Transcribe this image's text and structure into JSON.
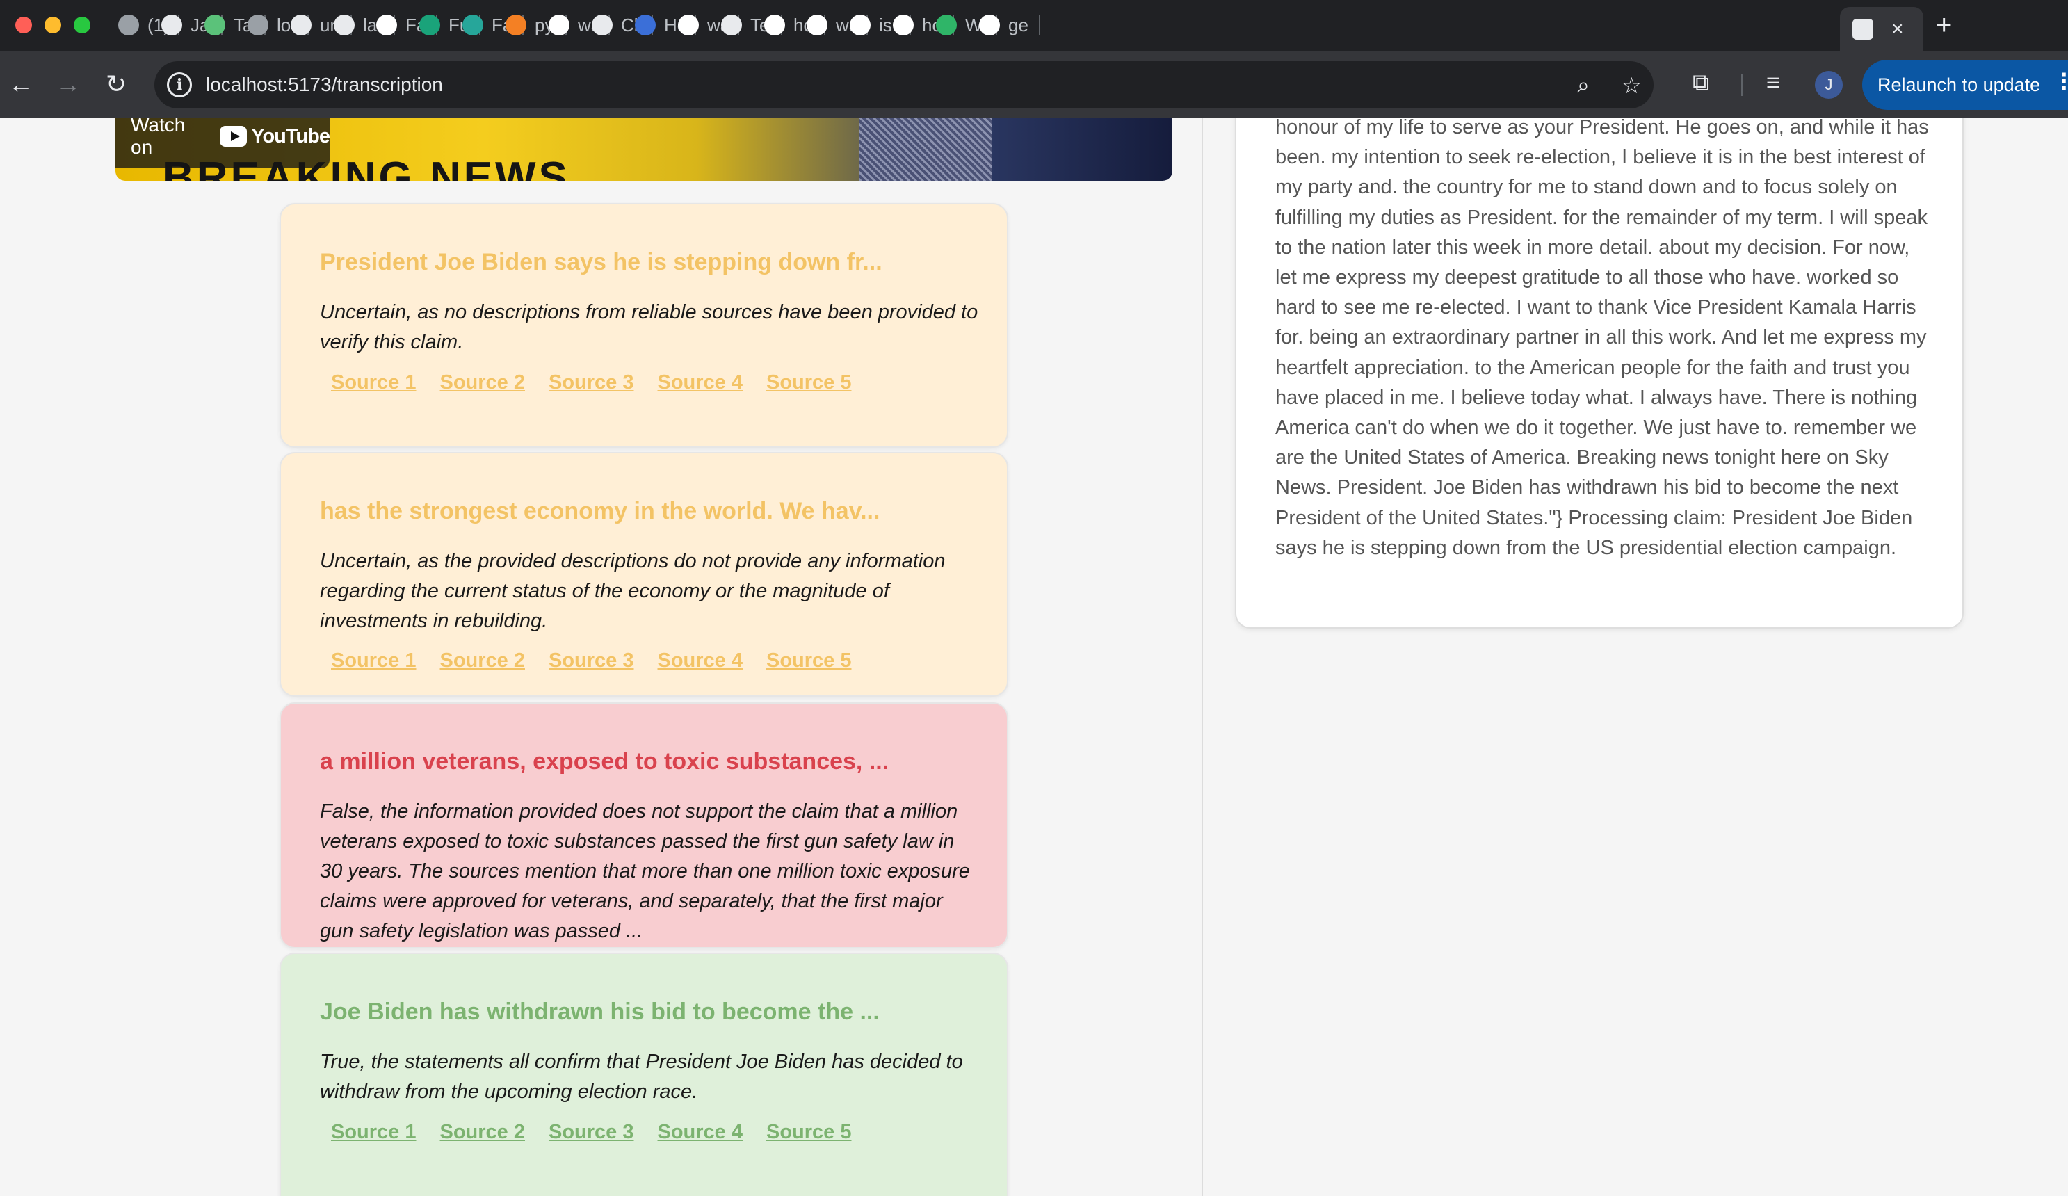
{
  "browser": {
    "tabs": [
      {
        "label": "(1)",
        "favicon": "laptop-icon",
        "color": "#9aa0a6"
      },
      {
        "label": "Ja",
        "favicon": "github-icon",
        "color": "#e8eaed"
      },
      {
        "label": "Ta",
        "favicon": "person-icon",
        "color": "#5bc27a"
      },
      {
        "label": "loc",
        "favicon": "globe-icon",
        "color": "#9aa0a6"
      },
      {
        "label": "un",
        "favicon": "github-icon",
        "color": "#e8eaed"
      },
      {
        "label": "lat",
        "favicon": "github-icon",
        "color": "#e8eaed"
      },
      {
        "label": "Fa",
        "favicon": "google-icon",
        "color": "#ffffff"
      },
      {
        "label": "Fu",
        "favicon": "bolt-icon",
        "color": "#1aa37a"
      },
      {
        "label": "Fa",
        "favicon": "doc-icon",
        "color": "#26a69a"
      },
      {
        "label": "py",
        "favicon": "stackoverflow-icon",
        "color": "#f48024"
      },
      {
        "label": "wa",
        "favicon": "google-icon",
        "color": "#ffffff"
      },
      {
        "label": "Cl",
        "favicon": "openai-icon",
        "color": "#e8eaed"
      },
      {
        "label": "Hc",
        "favicon": "notes-icon",
        "color": "#3b6fd8"
      },
      {
        "label": "wa",
        "favicon": "google-icon",
        "color": "#ffffff"
      },
      {
        "label": "Te",
        "favicon": "openai-icon",
        "color": "#e8eaed"
      },
      {
        "label": "ho",
        "favicon": "google-icon",
        "color": "#ffffff"
      },
      {
        "label": "wa",
        "favicon": "google-icon",
        "color": "#ffffff"
      },
      {
        "label": "is",
        "favicon": "google-icon",
        "color": "#ffffff"
      },
      {
        "label": "ho",
        "favicon": "google-icon",
        "color": "#ffffff"
      },
      {
        "label": "W",
        "favicon": "w-icon",
        "color": "#2fb568"
      },
      {
        "label": "ge",
        "favicon": "google-icon",
        "color": "#ffffff"
      }
    ],
    "active_tab": {
      "favicon": "page-icon",
      "close": "×"
    },
    "new_tab": "+",
    "url": "localhost:5173/transcription",
    "info_glyph": "i",
    "avatar_letter": "J",
    "relaunch_label": "Relaunch to update",
    "icons": {
      "back": "←",
      "forward": "→",
      "reload": "↻",
      "zoom": "⌕",
      "bookmark": "☆",
      "extensions": "⧉",
      "media": "≡",
      "kebab": "⋮"
    }
  },
  "video": {
    "watch_on": "Watch on",
    "youtube": "YouTube",
    "banner_text": "BREAKING NEWS"
  },
  "claims": [
    {
      "verdict": "uncertain",
      "title": "President Joe Biden says he is stepping down fr...",
      "explanation": "Uncertain, as no descriptions from reliable sources have been provided to verify this claim.",
      "sources": [
        "Source 1",
        "Source 2",
        "Source 3",
        "Source 4",
        "Source 5"
      ]
    },
    {
      "verdict": "uncertain",
      "title": "has the strongest economy in the world. We hav...",
      "explanation": "Uncertain, as the provided descriptions do not provide any information regarding the current status of the economy or the magnitude of investments in rebuilding.",
      "sources": [
        "Source 1",
        "Source 2",
        "Source 3",
        "Source 4",
        "Source 5"
      ]
    },
    {
      "verdict": "false",
      "title": "a million veterans, exposed to toxic substances, ...",
      "explanation": "False, the information provided does not support the claim that a million veterans exposed to toxic substances passed the first gun safety law in 30 years. The sources mention that more than one million toxic exposure claims were approved for veterans, and separately, that the first major gun safety legislation was passed ...",
      "sources": []
    },
    {
      "verdict": "true",
      "title": "Joe Biden has withdrawn his bid to become the ...",
      "explanation": "True, the statements all confirm that President Joe Biden has decided to withdraw from the upcoming election race.",
      "sources": [
        "Source 1",
        "Source 2",
        "Source 3",
        "Source 4",
        "Source 5"
      ]
    }
  ],
  "transcript": {
    "text": "honour of my life to serve as your President. He goes on, and while it has been. my intention to seek re-election, I believe it is in the best interest of my party and. the country for me to stand down and to focus solely on fulfilling my duties as President. for the remainder of my term. I will speak to the nation later this week in more detail. about my decision. For now, let me express my deepest gratitude to all those who have. worked so hard to see me re-elected. I want to thank Vice President Kamala Harris for. being an extraordinary partner in all this work. And let me express my heartfelt appreciation. to the American people for the faith and trust you have placed in me. I believe today what. I always have. There is nothing America can't do when we do it together. We just have to. remember we are the United States of America. Breaking news tonight here on Sky News. President. Joe Biden has withdrawn his bid to become the next President of the United States.\"} Processing claim: President Joe Biden says he is stepping down from the US presidential election campaign."
  },
  "colors": {
    "uncertain_bg": "#ffefd6",
    "uncertain_accent": "#f3c365",
    "false_bg": "#f8cdd0",
    "false_accent": "#d9424d",
    "true_bg": "#dff0da",
    "true_accent": "#7cb370",
    "relaunch_button": "#0b57a4"
  }
}
